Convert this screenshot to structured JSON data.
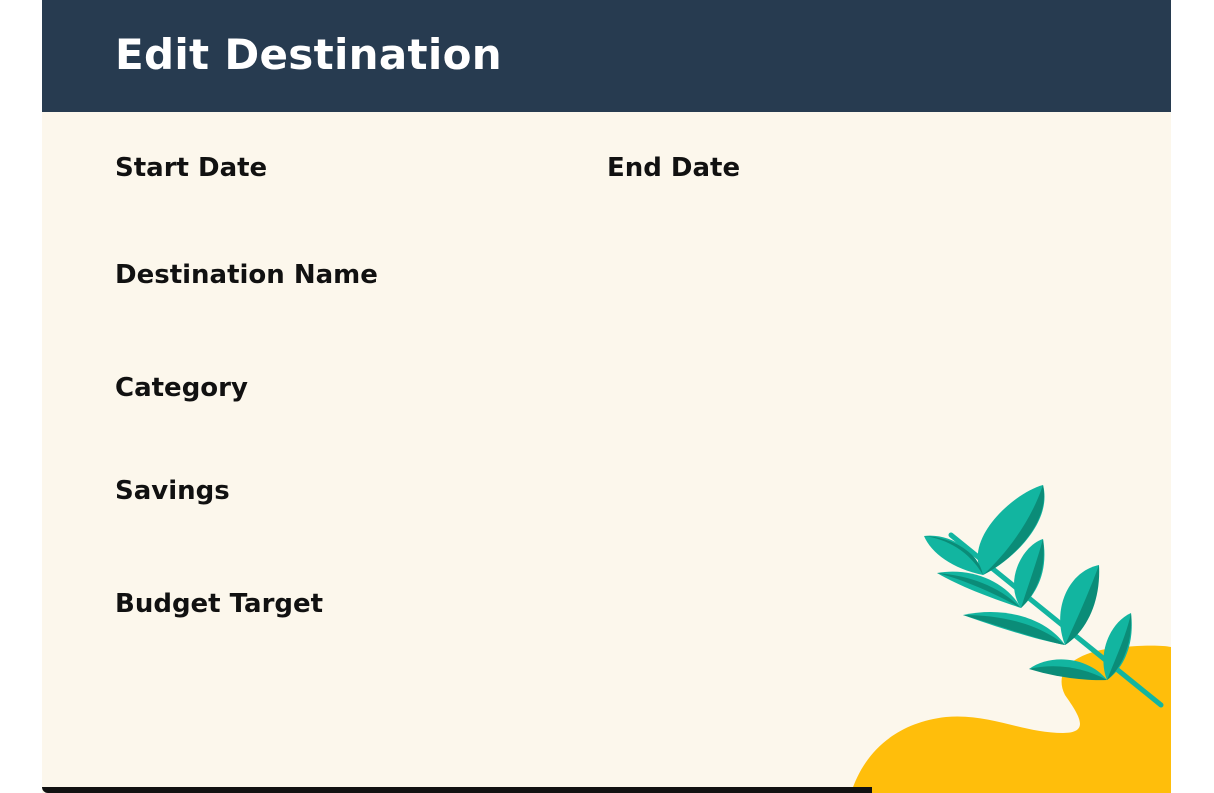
{
  "header": {
    "title": "Edit Destination"
  },
  "form": {
    "start_date": {
      "label": "Start Date",
      "value": ""
    },
    "end_date": {
      "label": "End Date",
      "value": ""
    },
    "destination_name": {
      "label": "Destination Name",
      "value": ""
    },
    "category": {
      "label": "Category",
      "value": ""
    },
    "savings": {
      "label": "Savings",
      "value": ""
    },
    "budget_target": {
      "label": "Budget Target",
      "value": ""
    }
  },
  "colors": {
    "header_bg": "#273b50",
    "card_bg": "#fcf7ec",
    "blob": "#ffbe0b",
    "leaf_light": "#12b5a0",
    "leaf_dark": "#0b8c78"
  },
  "icons": {
    "decoration": "plant-branch-illustration"
  }
}
